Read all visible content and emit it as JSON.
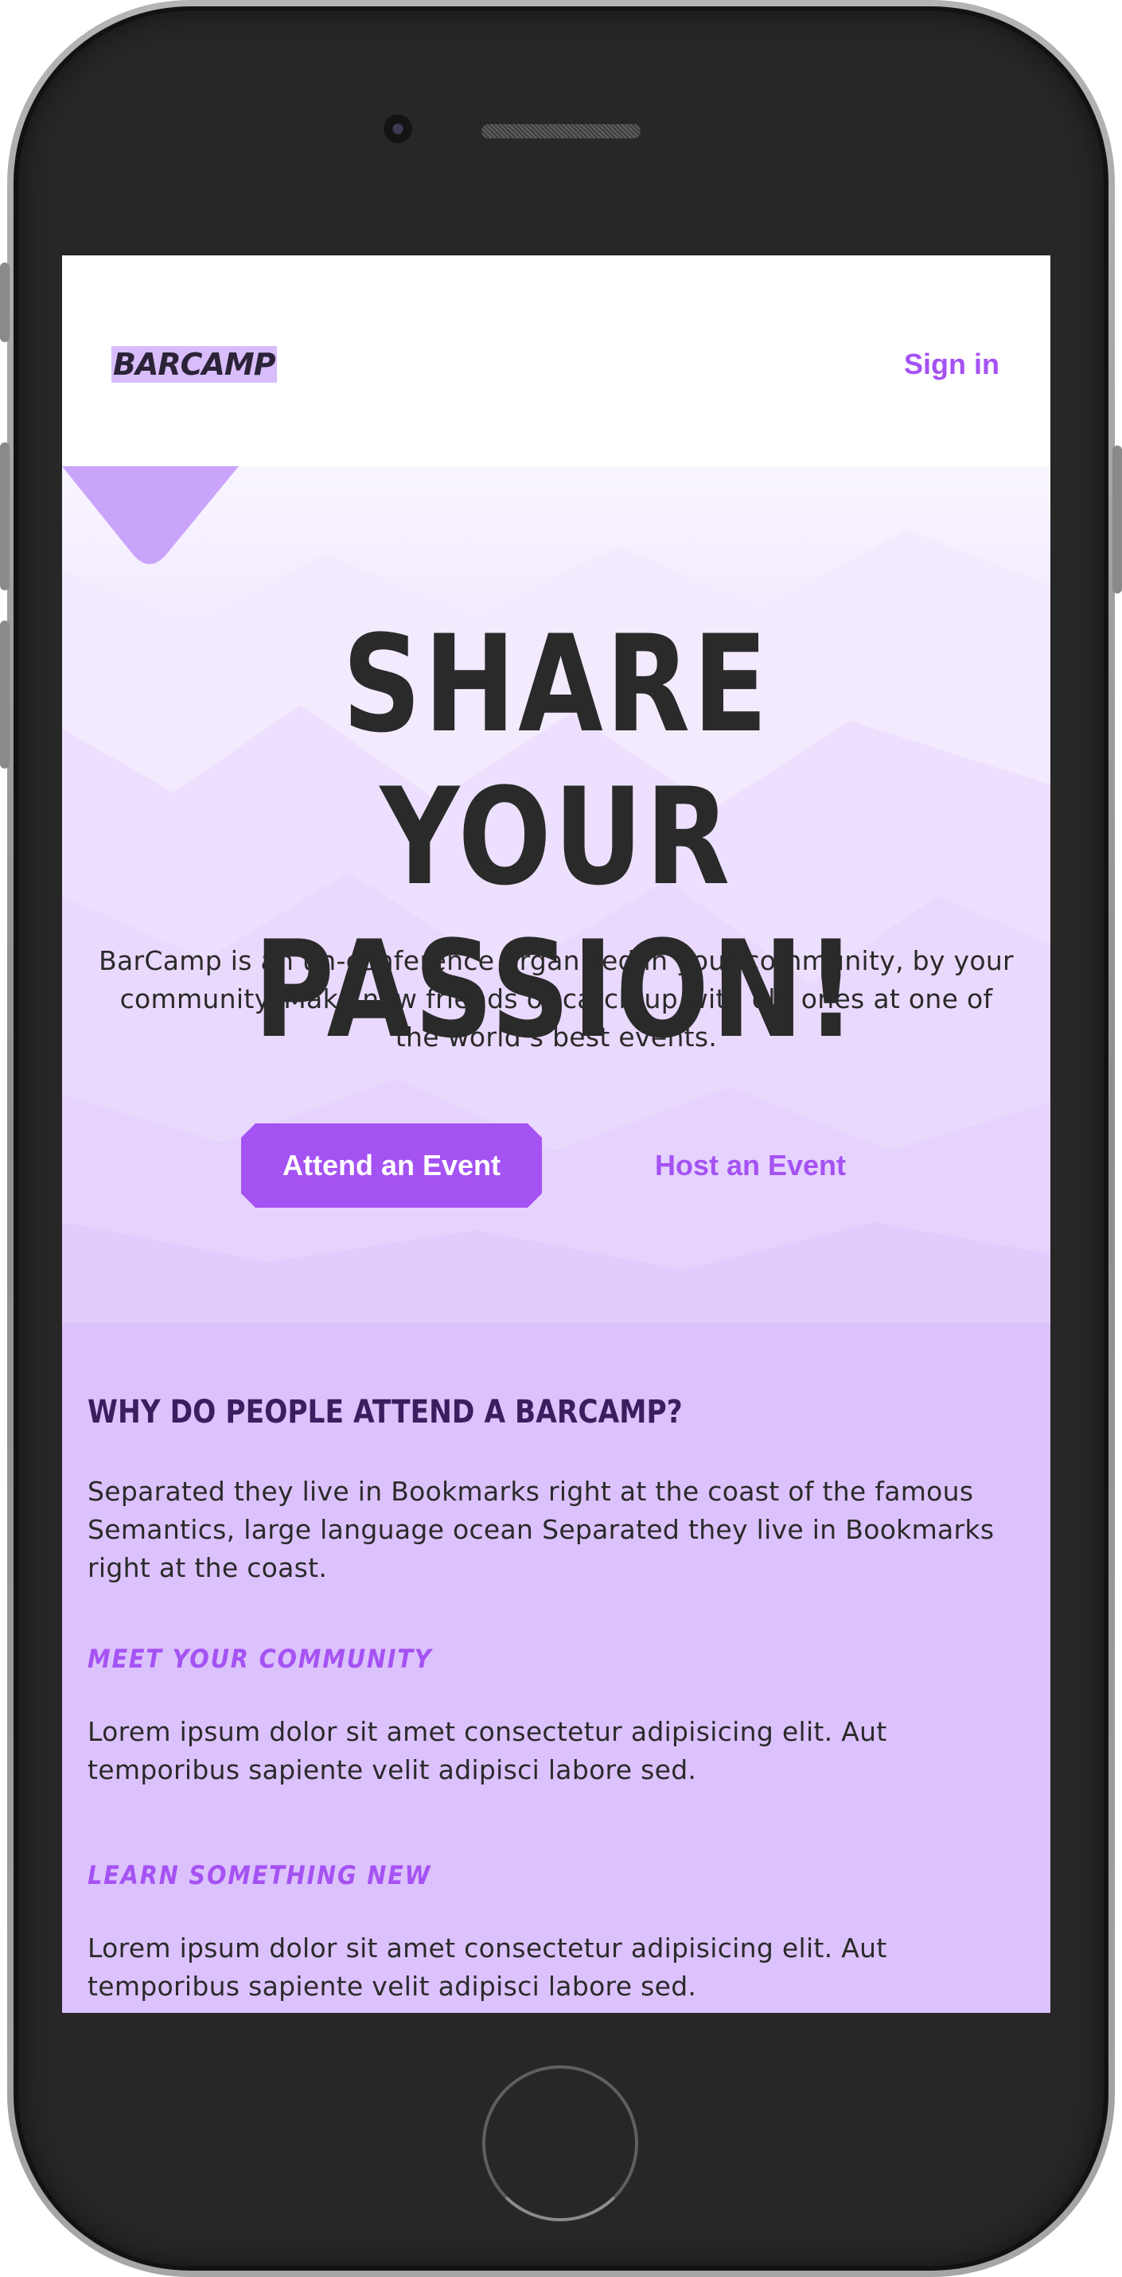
{
  "header": {
    "logo": "BARCAMP",
    "sign_in": "Sign in"
  },
  "hero": {
    "title_line1": "SHARE YOUR",
    "title_line2": "PASSION!",
    "description": "BarCamp is an un-conference organized in your community, by your community. Make new friends or catch up with old ones at one of the world’s best events.",
    "attend_label": "Attend an Event",
    "host_label": "Host an Event"
  },
  "why": {
    "title": "WHY DO PEOPLE ATTEND A BARCAMP?",
    "text": "Separated they live in Bookmarks right at the coast of the famous Semantics, large language ocean Separated they live in Bookmarks right at the coast.",
    "items": [
      {
        "title": "MEET YOUR COMMUNITY",
        "text": "Lorem ipsum dolor sit amet consectetur adipisicing elit. Aut temporibus sapiente velit adipisci labore sed."
      },
      {
        "title": "LEARN SOMETHING NEW",
        "text": "Lorem ipsum dolor sit amet consectetur adipisicing elit. Aut temporibus sapiente velit adipisci labore sed."
      }
    ]
  },
  "colors": {
    "accent": "#a552f3",
    "hero_bg": "#efe3fe",
    "section_bg": "#dcc2fc",
    "heading_dark": "#3c1d5f",
    "text": "#2a2a2a"
  }
}
